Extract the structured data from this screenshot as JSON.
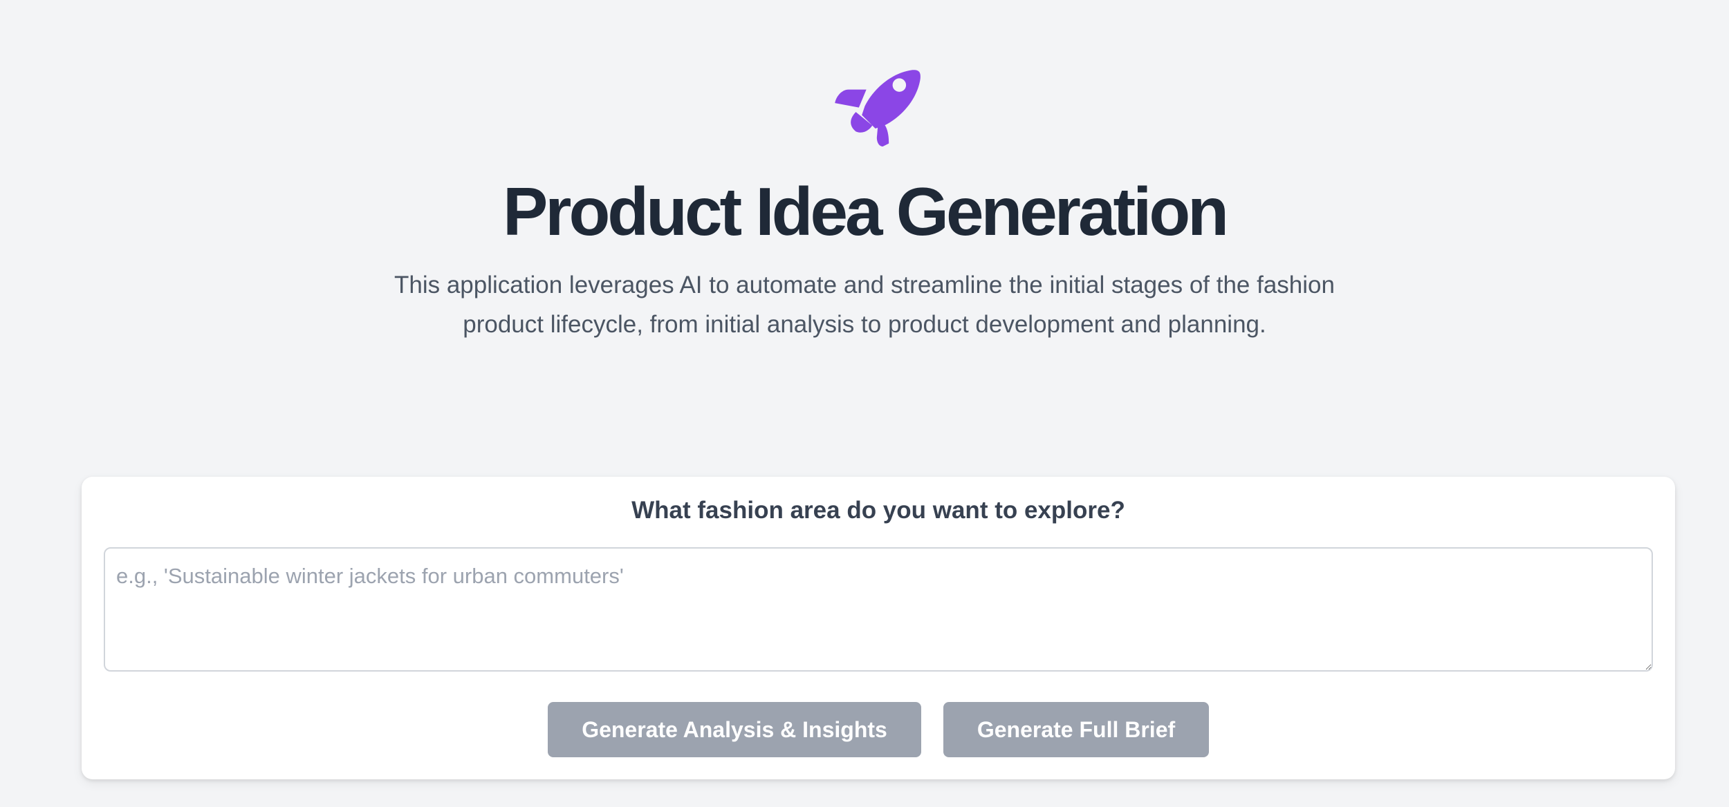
{
  "hero": {
    "icon": "rocket-icon",
    "icon_color": "#8b46e6",
    "title": "Product Idea Generation",
    "description": "This application leverages AI to automate and streamline the initial stages of the fashion product lifecycle, from initial analysis to product development and planning."
  },
  "form": {
    "label": "What fashion area do you want to explore?",
    "input_value": "",
    "placeholder": "e.g., 'Sustainable winter jackets for urban commuters'",
    "analysis_button_label": "Generate Analysis & Insights",
    "brief_button_label": "Generate Full Brief",
    "button_color": "#9ca3af"
  }
}
